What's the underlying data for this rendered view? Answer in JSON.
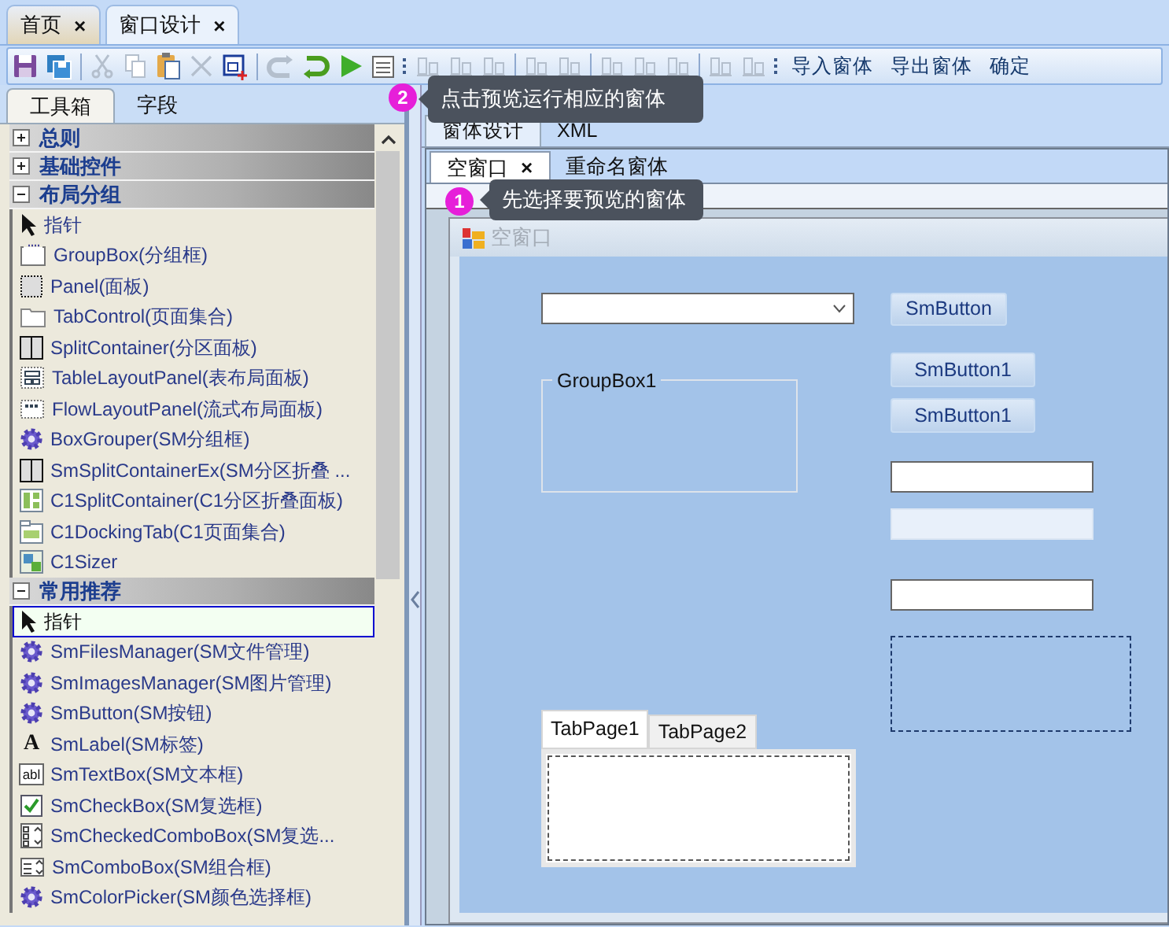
{
  "document_tabs": [
    {
      "label": "首页",
      "selected": false,
      "close": "×"
    },
    {
      "label": "窗口设计",
      "selected": true,
      "close": "×"
    }
  ],
  "toolbar": {
    "tools": [
      {
        "kind": "save",
        "disabled": false
      },
      {
        "kind": "saveall",
        "disabled": false
      },
      {
        "kind": "sep"
      },
      {
        "kind": "cut",
        "disabled": true
      },
      {
        "kind": "copy",
        "disabled": true
      },
      {
        "kind": "paste",
        "disabled": false
      },
      {
        "kind": "delete",
        "disabled": true
      },
      {
        "kind": "textbox",
        "disabled": false
      },
      {
        "kind": "sep"
      },
      {
        "kind": "redo",
        "disabled": true
      },
      {
        "kind": "undo",
        "disabled": false
      },
      {
        "kind": "run",
        "disabled": false
      },
      {
        "kind": "list",
        "disabled": false
      },
      {
        "kind": "grip"
      },
      {
        "kind": "align",
        "disabled": true
      },
      {
        "kind": "align",
        "disabled": true
      },
      {
        "kind": "align",
        "disabled": true
      },
      {
        "kind": "sep"
      },
      {
        "kind": "align",
        "disabled": true
      },
      {
        "kind": "align",
        "disabled": true
      },
      {
        "kind": "sep"
      },
      {
        "kind": "align",
        "disabled": true
      },
      {
        "kind": "align",
        "disabled": true
      },
      {
        "kind": "align",
        "disabled": true
      },
      {
        "kind": "sep"
      },
      {
        "kind": "align",
        "disabled": true
      },
      {
        "kind": "align",
        "disabled": true
      },
      {
        "kind": "grip"
      }
    ],
    "commands": [
      "导入窗体",
      "导出窗体",
      "确定"
    ]
  },
  "toolbox": {
    "tabs": [
      {
        "label": "工具箱",
        "selected": true
      },
      {
        "label": "字段",
        "selected": false
      }
    ],
    "groups": [
      {
        "title": "总则",
        "expanded": false
      },
      {
        "title": "基础控件",
        "expanded": false
      },
      {
        "title": "布局分组",
        "expanded": true,
        "items": [
          {
            "label": "指针",
            "kind": "pointer",
            "selected": false
          },
          {
            "label": "GroupBox(分组框)",
            "kind": "groupbox",
            "selected": false
          },
          {
            "label": "Panel(面板)",
            "kind": "panel",
            "selected": false
          },
          {
            "label": "TabControl(页面集合)",
            "kind": "tabcontrol",
            "selected": false
          },
          {
            "label": "SplitContainer(分区面板)",
            "kind": "split",
            "selected": false
          },
          {
            "label": "TableLayoutPanel(表布局面板)",
            "kind": "table",
            "selected": false
          },
          {
            "label": "FlowLayoutPanel(流式布局面板)",
            "kind": "flow",
            "selected": false
          },
          {
            "label": "BoxGrouper(SM分组框)",
            "kind": "gear",
            "selected": false
          },
          {
            "label": "SmSplitContainerEx(SM分区折叠 ...",
            "kind": "split",
            "selected": false
          },
          {
            "label": "C1SplitContainer(C1分区折叠面板)",
            "kind": "c1split",
            "selected": false
          },
          {
            "label": "C1DockingTab(C1页面集合)",
            "kind": "c1dock",
            "selected": false
          },
          {
            "label": "C1Sizer",
            "kind": "c1sizer",
            "selected": false
          }
        ]
      },
      {
        "title": "常用推荐",
        "expanded": true,
        "items": [
          {
            "label": "指针",
            "kind": "pointer",
            "selected": true
          },
          {
            "label": "SmFilesManager(SM文件管理)",
            "kind": "gear",
            "selected": false
          },
          {
            "label": "SmImagesManager(SM图片管理)",
            "kind": "gear",
            "selected": false
          },
          {
            "label": "SmButton(SM按钮)",
            "kind": "gear",
            "selected": false
          },
          {
            "label": "SmLabel(SM标签)",
            "kind": "glyph",
            "glyph": "A",
            "selected": false
          },
          {
            "label": "SmTextBox(SM文本框)",
            "kind": "glyph",
            "glyph": "abl",
            "selected": false
          },
          {
            "label": "SmCheckBox(SM复选框)",
            "kind": "checkbox",
            "selected": false
          },
          {
            "label": "SmCheckedComboBox(SM复选...",
            "kind": "checkedcombo",
            "selected": false
          },
          {
            "label": "SmComboBox(SM组合框)",
            "kind": "combo",
            "selected": false
          },
          {
            "label": "SmColorPicker(SM颜色选择框)",
            "kind": "gear",
            "selected": false
          }
        ]
      }
    ]
  },
  "designer": {
    "view_tabs": [
      {
        "label": "窗体设计",
        "selected": true
      },
      {
        "label": "XML",
        "selected": false
      }
    ],
    "form_tabs": [
      {
        "label": "空窗口",
        "selected": true,
        "close": "×"
      },
      {
        "label": "重命名窗体",
        "selected": false
      }
    ],
    "form": {
      "title": "空窗口",
      "controls": [
        {
          "kind": "combobox"
        },
        {
          "kind": "button",
          "label": "SmButton"
        },
        {
          "kind": "groupbox",
          "label": "GroupBox1"
        },
        {
          "kind": "button",
          "label": "SmButton1"
        },
        {
          "kind": "button",
          "label": "SmButton1"
        },
        {
          "kind": "textbox",
          "disabled": false
        },
        {
          "kind": "textbox",
          "disabled": true
        },
        {
          "kind": "textbox",
          "disabled": false
        },
        {
          "kind": "panel"
        },
        {
          "kind": "tabcontrol",
          "tabs": [
            {
              "label": "TabPage1",
              "selected": true
            },
            {
              "label": "TabPage2",
              "selected": false
            }
          ]
        }
      ]
    }
  },
  "hints": [
    {
      "number": "2",
      "text": "点击预览运行相应的窗体"
    },
    {
      "number": "1",
      "text": "先选择要预览的窗体"
    }
  ]
}
